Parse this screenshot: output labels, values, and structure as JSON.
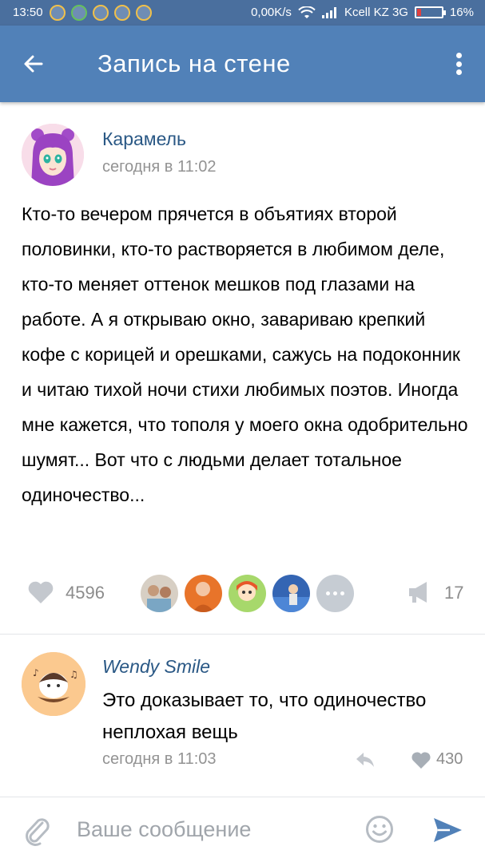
{
  "status_bar": {
    "time": "13:50",
    "speed": "0,00K/s",
    "carrier": "Kcell KZ 3G",
    "battery": "16%",
    "battery_level": 0.16
  },
  "header": {
    "title": "Запись на стене",
    "back_icon": "arrow-left-icon",
    "more_icon": "more-vertical-icon"
  },
  "post": {
    "author": "Карамель",
    "time": "сегодня в 11:02",
    "text": "Кто-то вечером прячется в объятиях второй половинки, кто-то растворяется в любимом деле, кто-то меняет оттенок мешков под глазами на работе. А я открываю окно, завариваю крепкий кофе с корицей и орешками, сажусь на подоконник и читаю тихой ночи стихи любимых поэтов. Иногда мне кажется, что тополя у моего окна одобрительно шумят... Вот что с людьми делает тотальное одиночество...",
    "likes": "4596",
    "shares": "17",
    "like_icon": "heart-icon",
    "share_icon": "megaphone-icon"
  },
  "comment": {
    "author": "Wendy Smile",
    "text": "Это доказывает то, что одиночество неплохая вещь",
    "time": "сегодня в 11:03",
    "likes": "430",
    "reply_icon": "reply-icon"
  },
  "composer": {
    "placeholder": "Ваше сообщение",
    "attach_icon": "paperclip-icon",
    "emoji_icon": "smiley-icon",
    "send_icon": "send-icon"
  },
  "colors": {
    "app_bar": "#5181b8",
    "status_bar": "#4a6f9e",
    "link": "#2a5885",
    "muted": "#939393"
  }
}
